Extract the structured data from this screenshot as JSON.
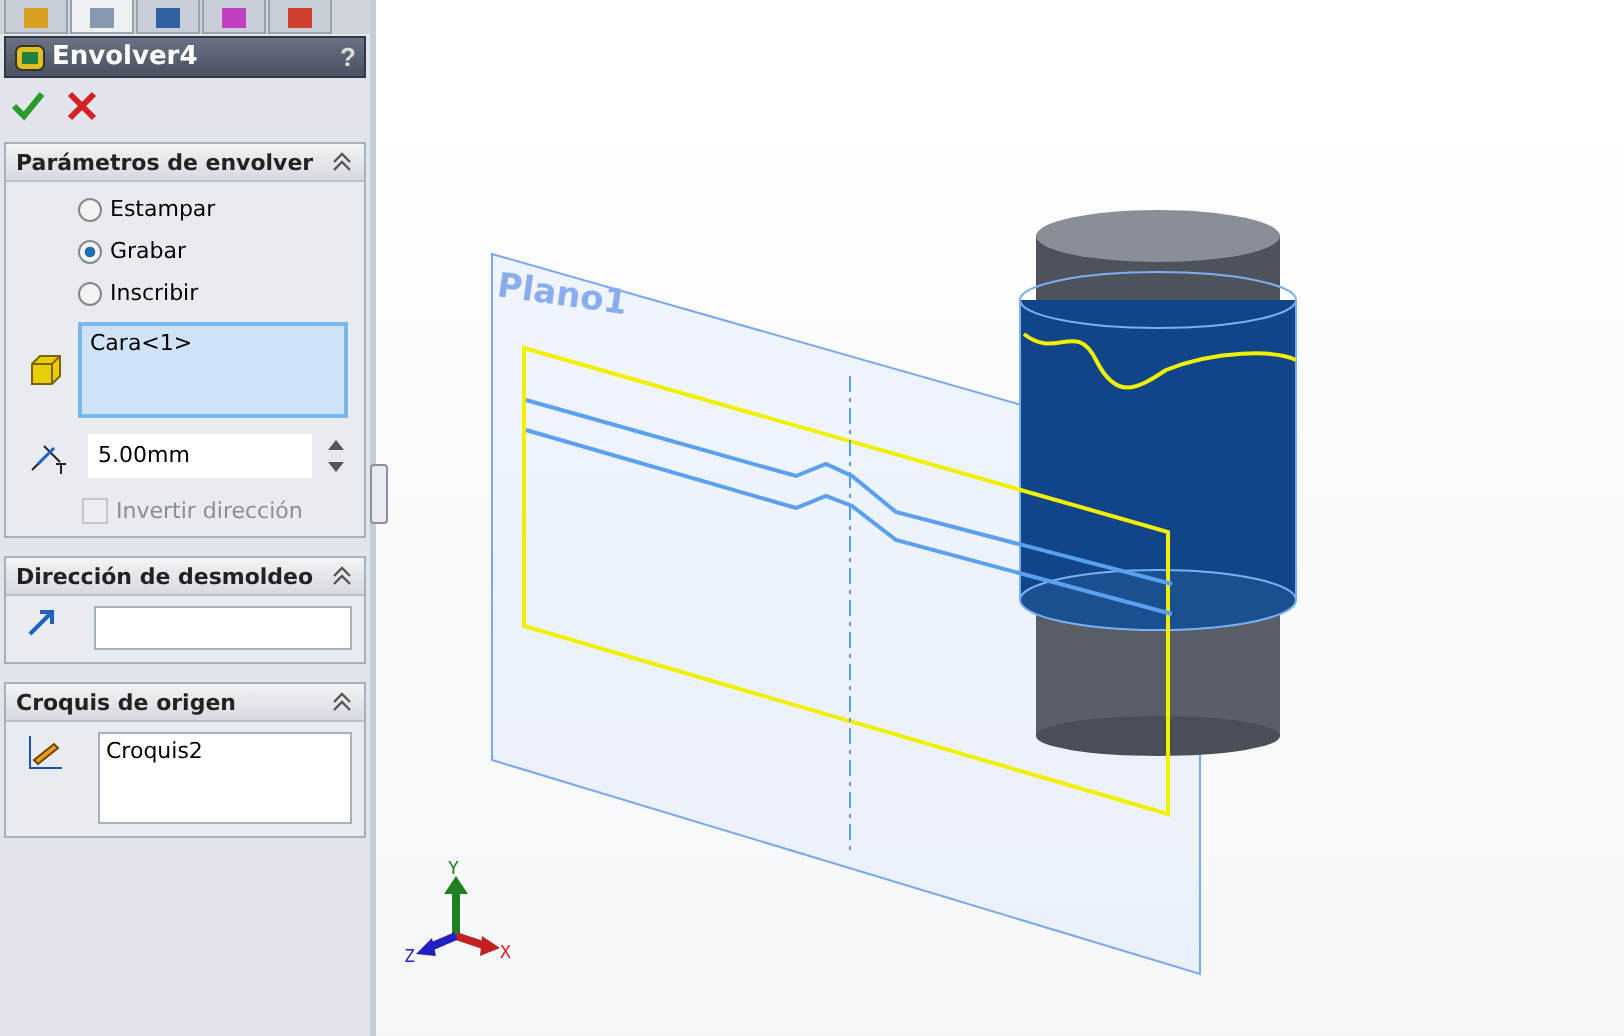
{
  "tabs": [
    {
      "selected": false
    },
    {
      "selected": true
    },
    {
      "selected": false
    },
    {
      "selected": false
    },
    {
      "selected": false
    }
  ],
  "feature": {
    "title": "Envolver4",
    "help": "?"
  },
  "groups": [
    {
      "kind": "params",
      "title": "Parámetros de envolver",
      "options": [
        {
          "label": "Estampar",
          "selected": false
        },
        {
          "label": "Grabar",
          "selected": true
        },
        {
          "label": "Inscribir",
          "selected": false
        }
      ],
      "face": "Cara<1>",
      "depth": "5.00mm",
      "reverse": {
        "label": "Invertir dirección",
        "checked": false,
        "disabled": true
      }
    },
    {
      "kind": "direction",
      "title": "Dirección de desmoldeo"
    },
    {
      "kind": "sketch",
      "title": "Croquis de origen",
      "value": "Croquis2"
    }
  ],
  "canvas": {
    "plane_label": "Plano1",
    "axes": {
      "y": "Y",
      "z": "Z",
      "x": "X"
    }
  }
}
